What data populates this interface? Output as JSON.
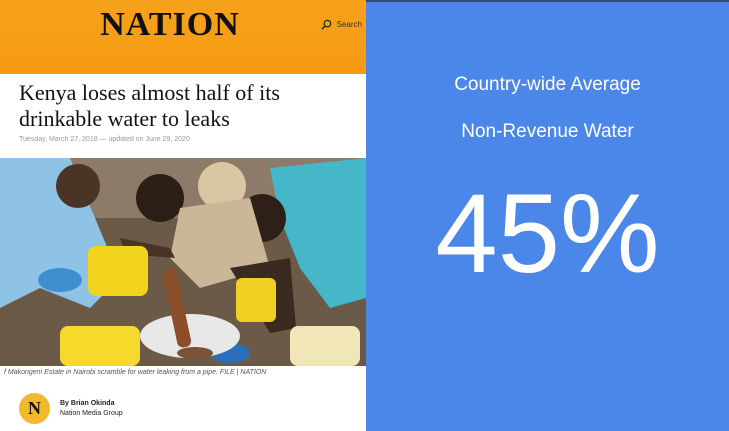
{
  "article": {
    "logo": "NATION",
    "search_label": "Search",
    "headline": "Kenya loses almost half of its drinkable water to leaks",
    "dateline": "Tuesday, March 27, 2018 — updated on June 29, 2020",
    "photo_caption": "f Makongeni Estate in Nairobi scramble for water leaking from a pipe. FILE | NATION",
    "author_badge": "N",
    "author_name": "By Brian Okinda",
    "author_org": "Nation Media Group"
  },
  "stat": {
    "line1": "Country-wide Average",
    "line2": "Non-Revenue Water",
    "value": "45%"
  },
  "colors": {
    "masthead": "#f59a12",
    "stat_panel": "#4a87e8",
    "badge": "#f2b92a"
  }
}
